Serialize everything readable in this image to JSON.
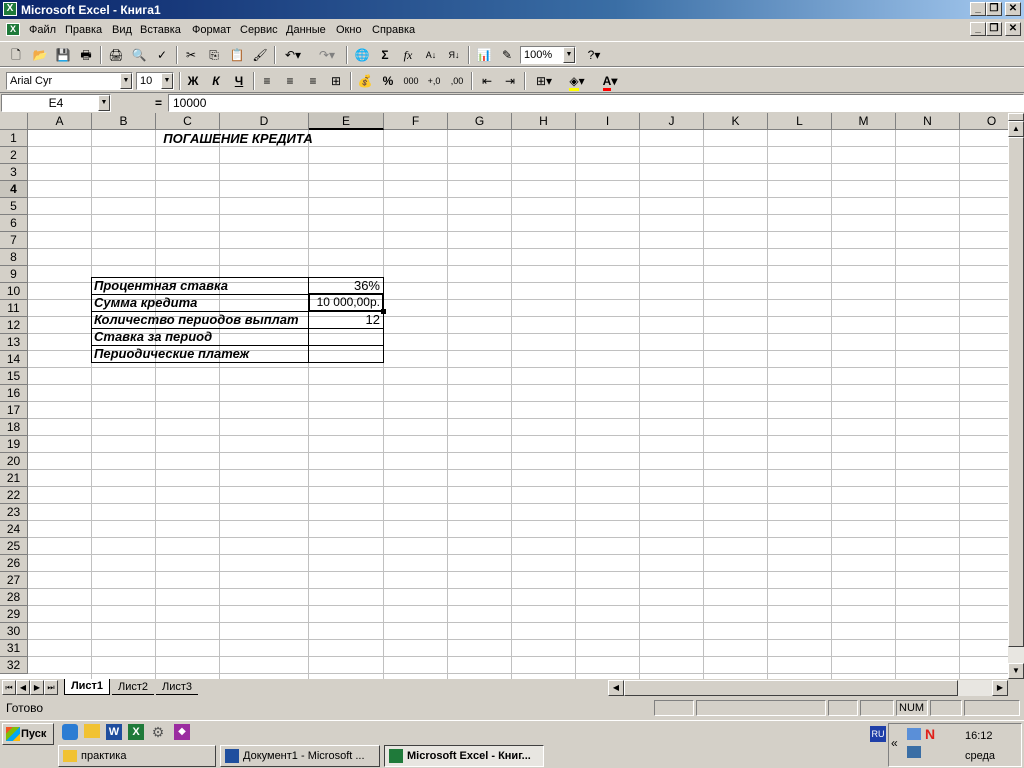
{
  "window": {
    "title": "Microsoft Excel - Книга1"
  },
  "menu": [
    "Файл",
    "Правка",
    "Вид",
    "Вставка",
    "Формат",
    "Сервис",
    "Данные",
    "Окно",
    "Справка"
  ],
  "toolbar": {
    "zoom": "100%",
    "font": "Arial Cyr",
    "size": "10",
    "bold": "Ж",
    "italic": "К",
    "underline": "Ч",
    "sigma": "Σ",
    "fx": "fx",
    "percent": "%",
    "thousands": "000"
  },
  "formula": {
    "name_box": "E4",
    "eq": "=",
    "value": "10000"
  },
  "columns": [
    "A",
    "B",
    "C",
    "D",
    "E",
    "F",
    "G",
    "H",
    "I",
    "J",
    "K",
    "L",
    "M",
    "N",
    "O"
  ],
  "rows": [
    "1",
    "2",
    "3",
    "4",
    "5",
    "6",
    "7",
    "8",
    "9",
    "10",
    "11",
    "12",
    "13",
    "14",
    "15",
    "16",
    "17",
    "18",
    "19",
    "20",
    "21",
    "22",
    "23",
    "24",
    "25",
    "26",
    "27",
    "28",
    "29",
    "30",
    "31",
    "32"
  ],
  "sheet": {
    "title": "ПОГАШЕНИЕ КРЕДИТА",
    "labels": [
      "Процентная ставка",
      "Сумма кредита",
      "Количество периодов выплат",
      "Ставка за период",
      "Периодические платеж"
    ],
    "values": [
      "36%",
      "10 000,00р.",
      "12",
      "",
      ""
    ]
  },
  "tabs": [
    "Лист1",
    "Лист2",
    "Лист3"
  ],
  "status": {
    "ready": "Готово",
    "num": "NUM"
  },
  "taskbar": {
    "start": "Пуск",
    "tasks": [
      "практика",
      "Документ1 - Microsoft ...",
      "Microsoft Excel - Книг..."
    ],
    "lang": "RU",
    "time": "16:12",
    "day": "среда"
  }
}
